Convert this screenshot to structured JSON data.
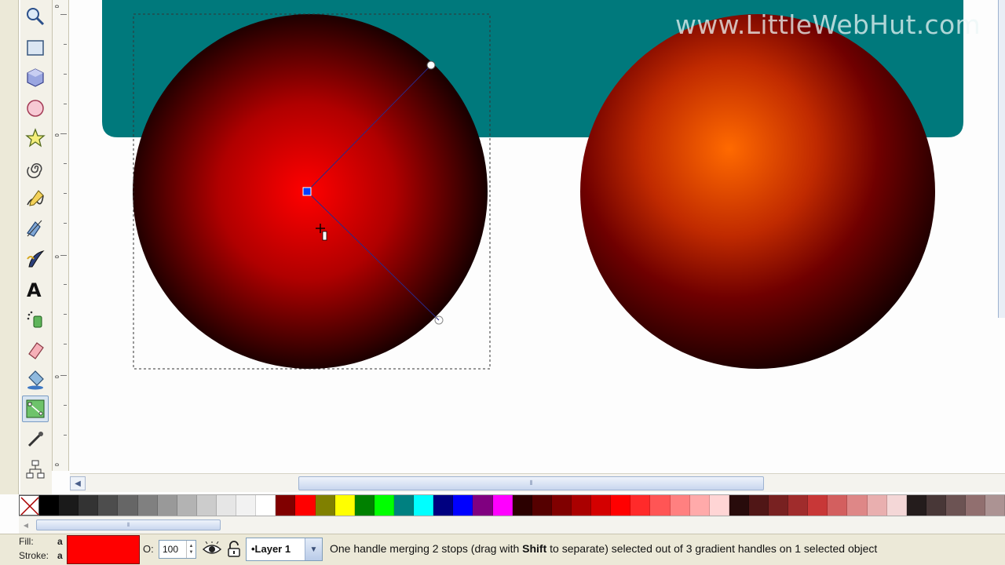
{
  "watermark": "www.LittleWebHut.com",
  "toolbox": {
    "tools": [
      {
        "name": "zoom-tool-icon"
      },
      {
        "name": "rectangle-tool-icon"
      },
      {
        "name": "3d-box-tool-icon"
      },
      {
        "name": "ellipse-tool-icon"
      },
      {
        "name": "star-tool-icon"
      },
      {
        "name": "spiral-tool-icon"
      },
      {
        "name": "pencil-tool-icon"
      },
      {
        "name": "pen-tool-icon"
      },
      {
        "name": "calligraphy-tool-icon"
      },
      {
        "name": "text-tool-icon"
      },
      {
        "name": "spray-tool-icon"
      },
      {
        "name": "eraser-tool-icon"
      },
      {
        "name": "paint-bucket-tool-icon"
      },
      {
        "name": "gradient-tool-icon",
        "active": true
      },
      {
        "name": "dropper-tool-icon"
      },
      {
        "name": "connector-tool-icon"
      }
    ],
    "text_tool_glyph": "A"
  },
  "ruler": {
    "labels": [
      "0",
      "0",
      "0",
      "0",
      "0"
    ]
  },
  "colors": {
    "teal": "#00797c",
    "canvas_bg": "#fdfdfd",
    "gradient_center_left": "#ff0000",
    "gradient_center_right": "#ff6a00"
  },
  "palette": {
    "swatches": [
      "#000000",
      "#1a1a1a",
      "#333333",
      "#4d4d4d",
      "#666666",
      "#808080",
      "#999999",
      "#b3b3b3",
      "#cccccc",
      "#e6e6e6",
      "#f2f2f2",
      "#ffffff",
      "#800000",
      "#ff0000",
      "#808000",
      "#ffff00",
      "#008000",
      "#00ff00",
      "#008080",
      "#00ffff",
      "#000080",
      "#0000ff",
      "#800080",
      "#ff00ff",
      "#2b0000",
      "#550000",
      "#800000",
      "#aa0000",
      "#d40000",
      "#ff0000",
      "#ff2a2a",
      "#ff5555",
      "#ff8080",
      "#ffaaaa",
      "#ffd5d5",
      "#280b0b",
      "#501616",
      "#782121",
      "#a02c2c",
      "#c83737",
      "#d35f5f",
      "#de8787",
      "#e9afaf",
      "#f4d7d7",
      "#241c1c",
      "#483737",
      "#6c5353",
      "#916f6f",
      "#ac9393"
    ]
  },
  "status": {
    "fill_label": "Fill:",
    "fill_value": "a",
    "stroke_label": "Stroke:",
    "stroke_value": "a",
    "fill_color": "#ff0000",
    "opacity_label": "O:",
    "opacity_value": "100",
    "layer_name": "•Layer 1",
    "message_pre": "One handle merging 2 stops (drag with ",
    "message_bold": "Shift",
    "message_post": " to separate) selected out of 3 gradient handles on 1 selected object"
  }
}
